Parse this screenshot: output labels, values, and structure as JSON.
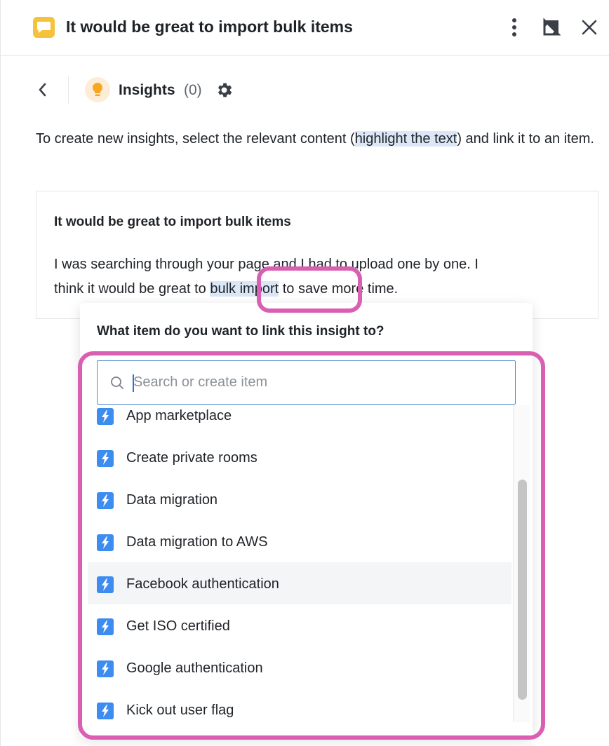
{
  "header": {
    "title": "It would be great to import bulk items"
  },
  "insights": {
    "label": "Insights",
    "count": "(0)"
  },
  "intro": {
    "before": "To create new insights, select the relevant content (",
    "highlight": "highlight the text",
    "after": ") and link it to an item."
  },
  "feedback": {
    "title": "It would be great to import bulk items",
    "body_before": "I was searching through your page and I had to upload one by one. I think it would be great to ",
    "body_highlight": "bulk import",
    "body_after": " to save more time."
  },
  "popover": {
    "title": "What item do you want to link this insight to?",
    "search_placeholder": "Search or create item",
    "items": [
      {
        "label": "App marketplace"
      },
      {
        "label": "Create private rooms"
      },
      {
        "label": "Data migration"
      },
      {
        "label": "Data migration to AWS"
      },
      {
        "label": "Facebook authentication"
      },
      {
        "label": "Get ISO certified"
      },
      {
        "label": "Google authentication"
      },
      {
        "label": "Kick out user flag"
      }
    ],
    "hovered_item": "Facebook authentication"
  },
  "colors": {
    "accent_highlight": "#dbe7f6",
    "annotation_ring": "#d95fb3",
    "item_icon": "#3d8cf0",
    "app_icon": "#f5c33b"
  }
}
